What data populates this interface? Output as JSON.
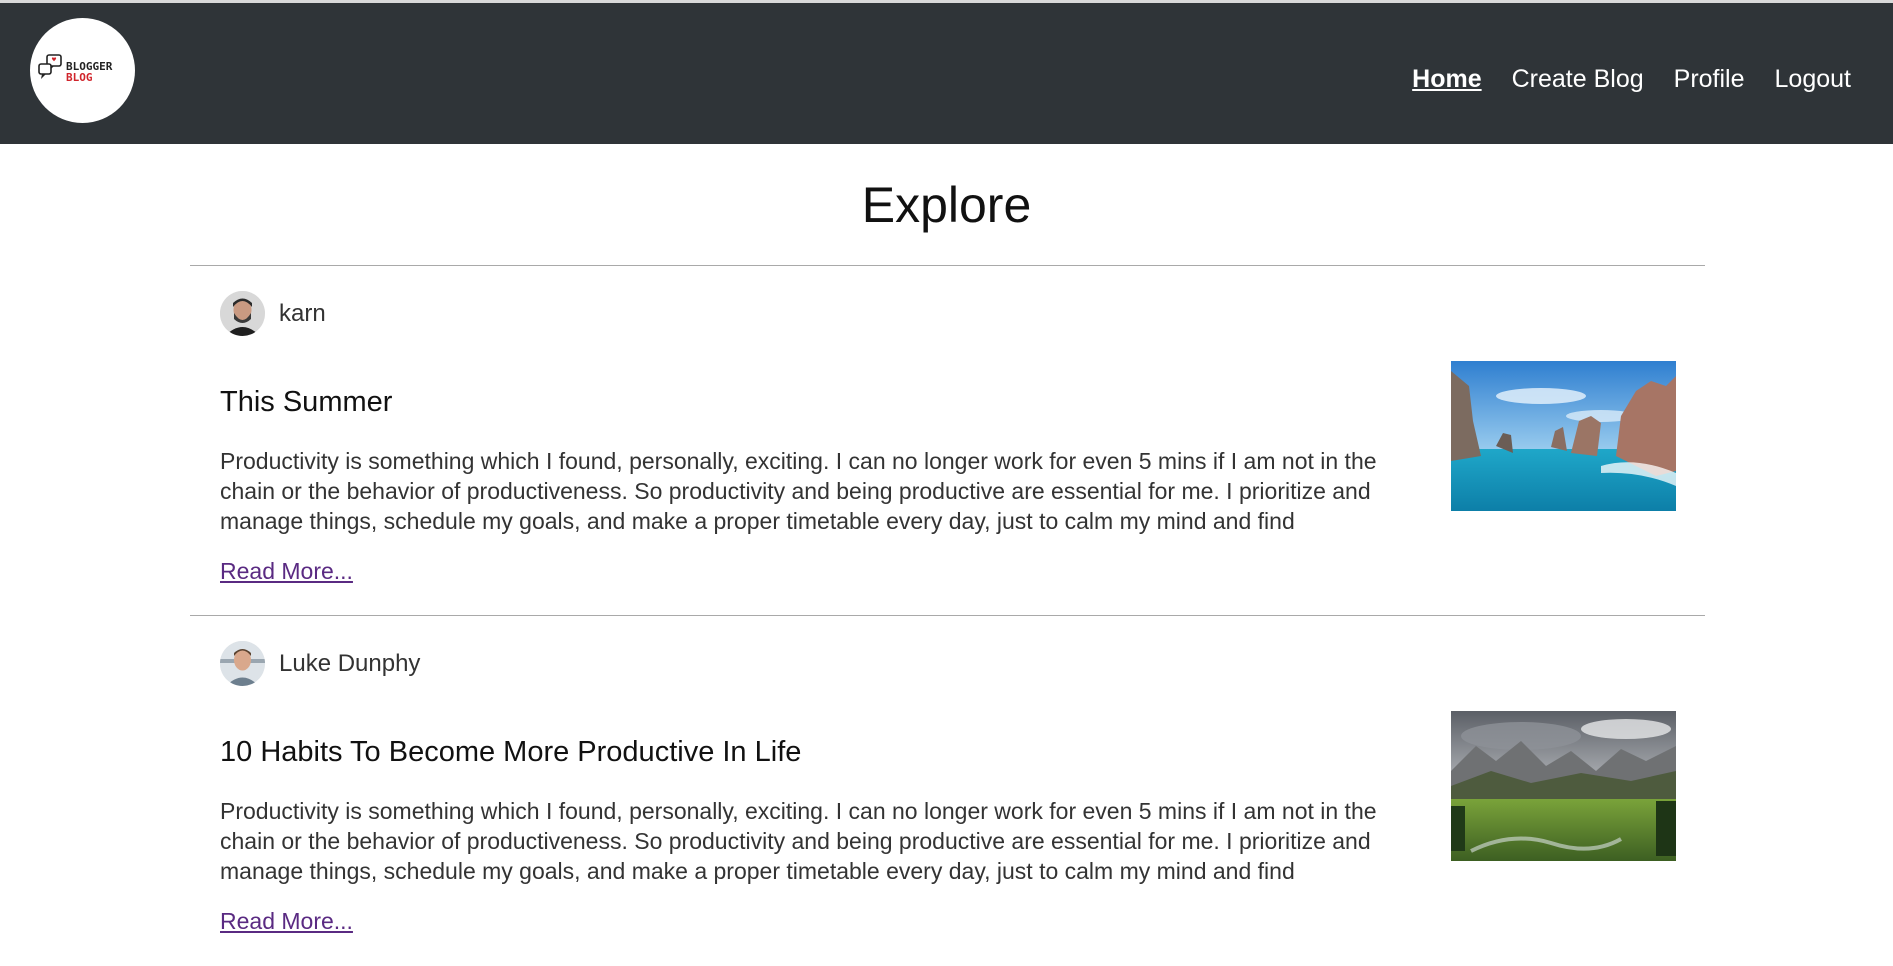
{
  "logo": {
    "line1": "BLOGGER",
    "line2": "BLOG"
  },
  "nav": {
    "items": [
      {
        "label": "Home",
        "active": true
      },
      {
        "label": "Create Blog",
        "active": false
      },
      {
        "label": "Profile",
        "active": false
      },
      {
        "label": "Logout",
        "active": false
      }
    ]
  },
  "page": {
    "title": "Explore"
  },
  "posts": [
    {
      "author": "karn",
      "title": "This Summer",
      "excerpt": "Productivity is something which I found, personally, exciting. I can no longer work for even 5 mins if I am not in the chain or the behavior of productiveness. So productivity and being productive are essential for me. I prioritize and manage things, schedule my goals, and make a proper timetable every day, just to calm my mind and find",
      "read_more": "Read More...",
      "image": "coastal-rock-arches-photo"
    },
    {
      "author": "Luke Dunphy",
      "title": "10 Habits To Become More Productive In Life",
      "excerpt": "Productivity is something which I found, personally, exciting. I can no longer work for even 5 mins if I am not in the chain or the behavior of productiveness. So productivity and being productive are essential for me. I prioritize and manage things, schedule my goals, and make a proper timetable every day, just to calm my mind and find",
      "read_more": "Read More...",
      "image": "mountain-meadow-photo"
    }
  ],
  "colors": {
    "navbar": "#2f3438",
    "link_visited": "#5a2a82",
    "logo_red": "#d0242b"
  }
}
